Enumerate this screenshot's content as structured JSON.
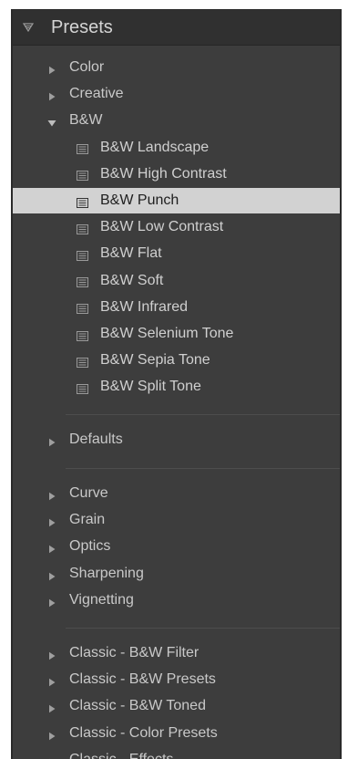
{
  "panel": {
    "title": "Presets"
  },
  "groups_top": [
    {
      "label": "Color",
      "expanded": false
    },
    {
      "label": "Creative",
      "expanded": false
    },
    {
      "label": "B&W",
      "expanded": true
    }
  ],
  "bw_presets": [
    {
      "label": "B&W Landscape",
      "selected": false
    },
    {
      "label": "B&W High Contrast",
      "selected": false
    },
    {
      "label": "B&W Punch",
      "selected": true
    },
    {
      "label": "B&W Low Contrast",
      "selected": false
    },
    {
      "label": "B&W Flat",
      "selected": false
    },
    {
      "label": "B&W Soft",
      "selected": false
    },
    {
      "label": "B&W Infrared",
      "selected": false
    },
    {
      "label": "B&W Selenium Tone",
      "selected": false
    },
    {
      "label": "B&W Sepia Tone",
      "selected": false
    },
    {
      "label": "B&W Split Tone",
      "selected": false
    }
  ],
  "group_defaults": {
    "label": "Defaults",
    "expanded": false
  },
  "groups_mid": [
    {
      "label": "Curve",
      "expanded": false
    },
    {
      "label": "Grain",
      "expanded": false
    },
    {
      "label": "Optics",
      "expanded": false
    },
    {
      "label": "Sharpening",
      "expanded": false
    },
    {
      "label": "Vignetting",
      "expanded": false
    }
  ],
  "groups_bottom": [
    {
      "label": "Classic - B&W Filter",
      "expanded": false
    },
    {
      "label": "Classic - B&W Presets",
      "expanded": false
    },
    {
      "label": "Classic - B&W Toned",
      "expanded": false
    },
    {
      "label": "Classic - Color Presets",
      "expanded": false
    },
    {
      "label": "Classic - Effects",
      "expanded": false
    }
  ],
  "colors": {
    "panel_bg": "#3d3d3d",
    "header_bg": "#303030",
    "selected_bg": "#d2d2d2",
    "text": "#c9c9c9"
  },
  "icons": {
    "collapse_toggle": "triangle-down-icon",
    "group_collapsed": "triangle-right-icon",
    "group_expanded": "triangle-down-icon",
    "preset": "preset-icon"
  }
}
